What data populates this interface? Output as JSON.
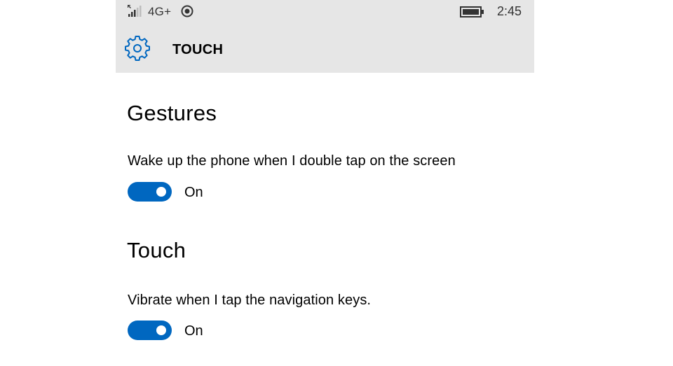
{
  "status_bar": {
    "network": "4G+",
    "time": "2:45",
    "icons": [
      "signal-icon",
      "location-icon",
      "battery-icon"
    ]
  },
  "header": {
    "icon": "gear-icon",
    "title": "TOUCH"
  },
  "sections": [
    {
      "heading": "Gestures",
      "setting": {
        "label": "Wake up the phone when I double tap on the screen",
        "state": "On"
      }
    },
    {
      "heading": "Touch",
      "setting": {
        "label": "Vibrate when I tap the navigation keys.",
        "state": "On"
      }
    }
  ],
  "colors": {
    "accent": "#0067c0",
    "header_background": "#e6e6e6",
    "background": "#ffffff"
  }
}
